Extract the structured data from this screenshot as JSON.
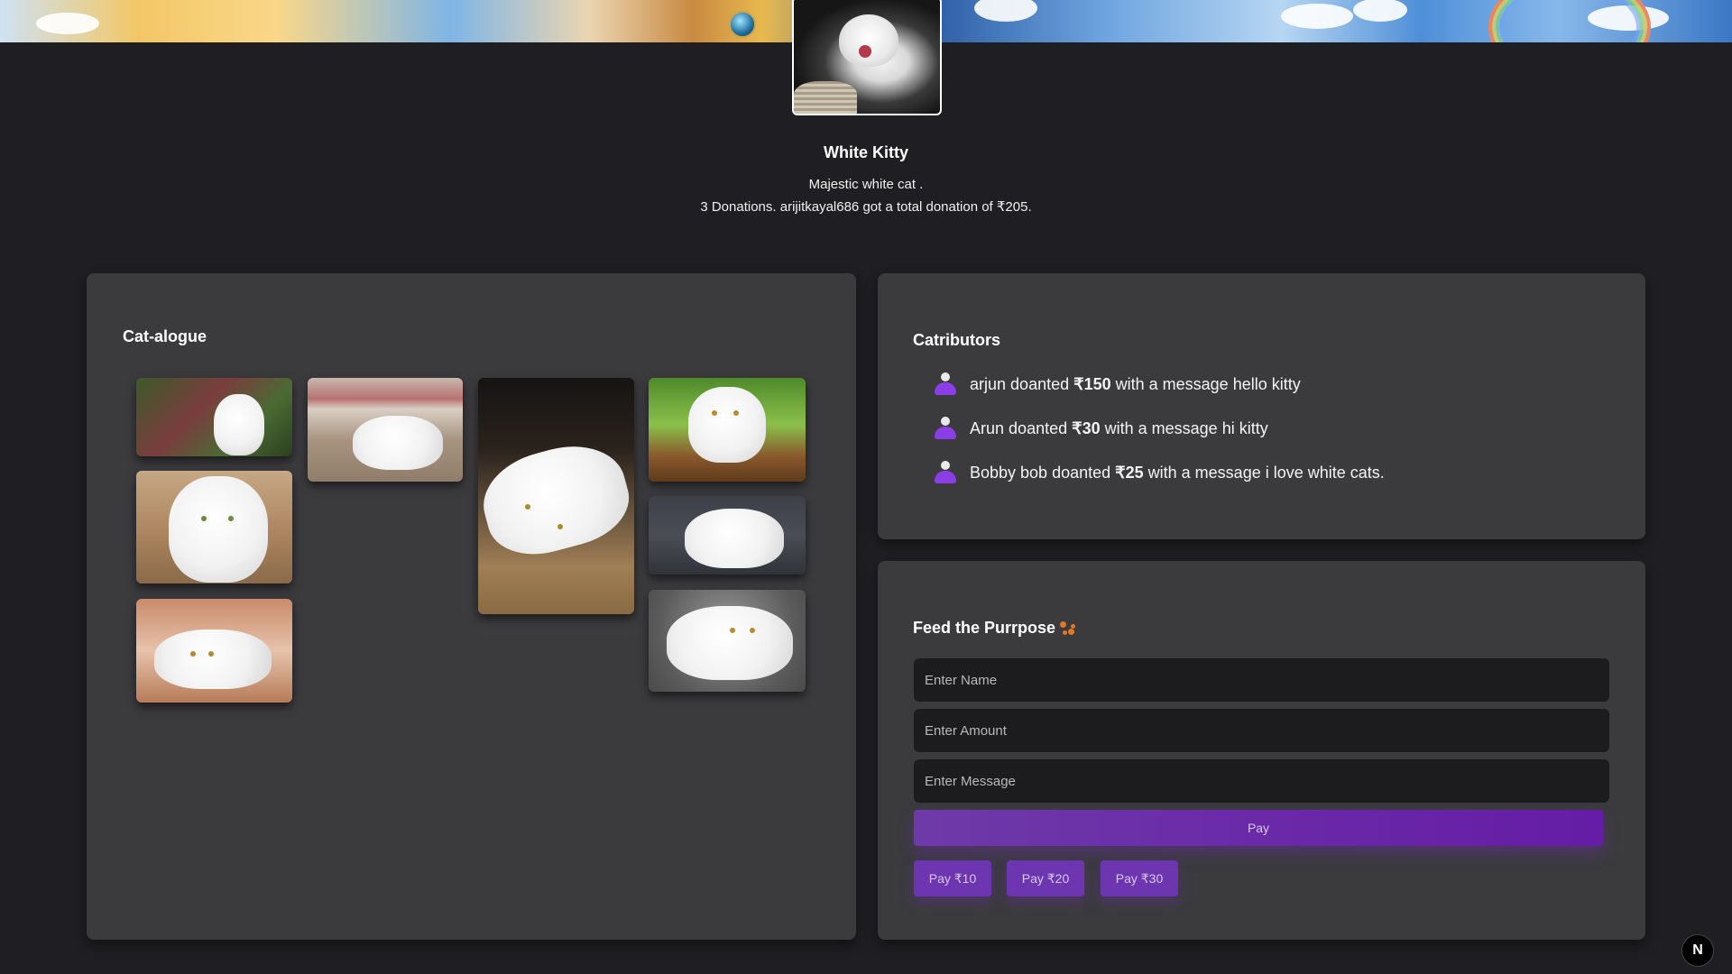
{
  "profile": {
    "name": "White Kitty",
    "description": "Majestic white cat .",
    "stats": "3 Donations. arijitkayal686 got a total donation of ₹205."
  },
  "gallery": {
    "title": "Cat-alogue",
    "photos": [
      "cat-photo-1",
      "cat-photo-2",
      "cat-photo-3",
      "cat-photo-4",
      "cat-photo-5",
      "cat-photo-6",
      "cat-photo-7",
      "cat-photo-8",
      "cat-photo-9"
    ]
  },
  "contributors": {
    "title": "Catributors",
    "items": [
      {
        "name": "arjun",
        "verb": "doanted",
        "amount": "₹150",
        "connector": "with a message",
        "message": "hello kitty"
      },
      {
        "name": "Arun",
        "verb": "doanted",
        "amount": "₹30",
        "connector": "with a message",
        "message": "hi kitty"
      },
      {
        "name": "Bobby bob",
        "verb": "doanted",
        "amount": "₹25",
        "connector": "with a message",
        "message": "i love white cats."
      }
    ]
  },
  "payment": {
    "title": "Feed the Purrpose",
    "title_icon": "paw-prints-icon",
    "name_placeholder": "Enter Name",
    "amount_placeholder": "Enter Amount",
    "message_placeholder": "Enter Message",
    "pay_label": "Pay",
    "quick_amounts": [
      "Pay ₹10",
      "Pay ₹20",
      "Pay ₹30"
    ]
  },
  "badge": {
    "label": "N"
  },
  "colors": {
    "background": "#1f1f23",
    "panel": "#3b3b3e",
    "accent": "#6d35b0",
    "user_icon": "#8b3ee6"
  }
}
